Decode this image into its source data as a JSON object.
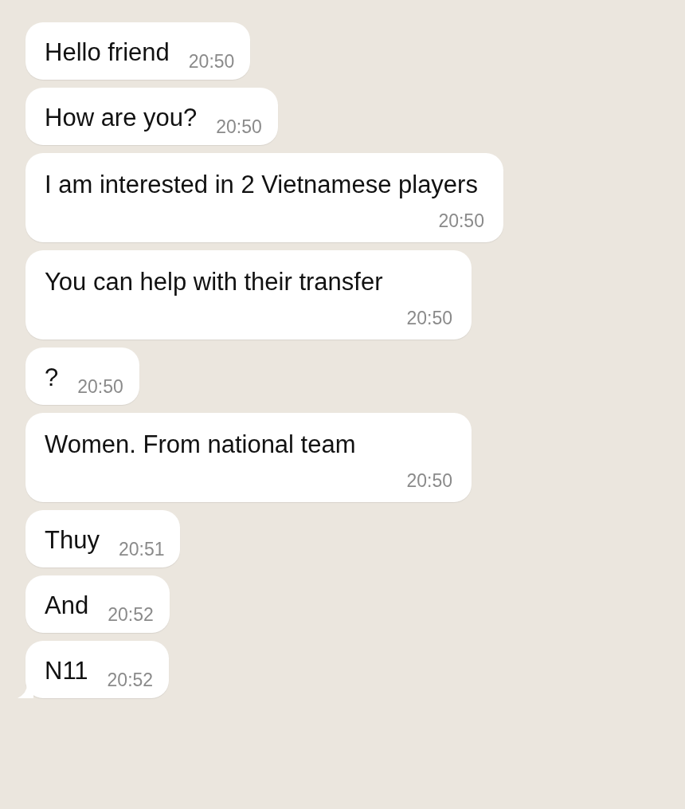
{
  "messages": [
    {
      "kind": "inline",
      "text": "Hello friend",
      "time": "20:50",
      "tail": false
    },
    {
      "kind": "inline",
      "text": "How are you?",
      "time": "20:50",
      "tail": false
    },
    {
      "kind": "stacked",
      "text": "I am interested in 2 Vietnamese players",
      "time": "20:50",
      "tail": false
    },
    {
      "kind": "stacked",
      "text": "You can help with their transfer",
      "time": "20:50",
      "tail": false
    },
    {
      "kind": "inline",
      "text": "?",
      "time": "20:50",
      "tail": false
    },
    {
      "kind": "stacked",
      "text": "Women. From national team",
      "time": "20:50",
      "tail": false
    },
    {
      "kind": "inline",
      "text": "Thuy",
      "time": "20:51",
      "tail": false
    },
    {
      "kind": "inline",
      "text": "And",
      "time": "20:52",
      "tail": false
    },
    {
      "kind": "inline",
      "text": "N11",
      "time": "20:52",
      "tail": true
    }
  ]
}
